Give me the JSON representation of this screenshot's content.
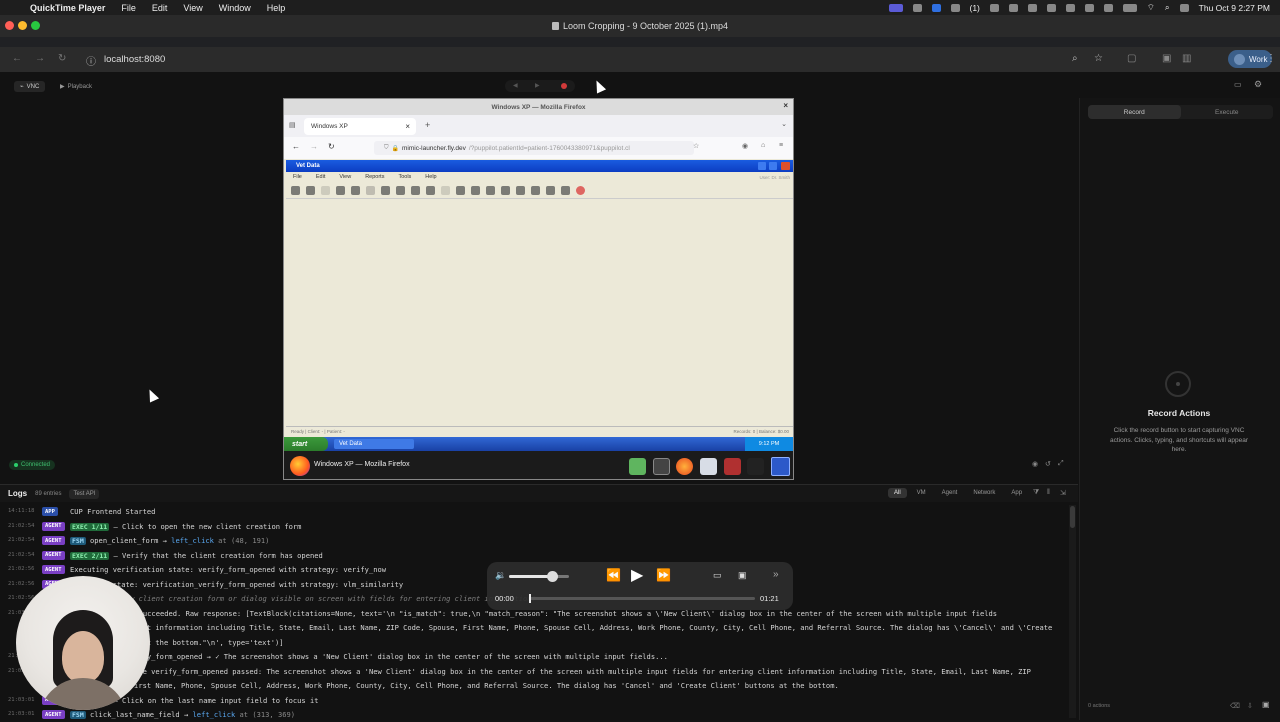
{
  "menubar": {
    "app": "QuickTime Player",
    "items": [
      "File",
      "Edit",
      "View",
      "Window",
      "Help"
    ],
    "status_count": "(1)",
    "clock": "Thu Oct 9  2:27 PM"
  },
  "window": {
    "title": "Loom Cropping - 9 October 2025 (1).mp4"
  },
  "browser": {
    "url": "localhost:8080",
    "profile_label": "Work"
  },
  "app": {
    "mode_tabs": [
      "VNC",
      "Playback"
    ],
    "connection_status": "Connected"
  },
  "vnc": {
    "window_title": "Windows XP — Mozilla Firefox",
    "tab_label": "Windows XP",
    "url_host": "mimic-launcher.fly.dev",
    "url_rest": "/?puppilot.patientId=patient-1760043380971&puppilot.cl",
    "vet_title": "Vet Data",
    "vet_menu": [
      "File",
      "Edit",
      "View",
      "Reports",
      "Tools",
      "Help"
    ],
    "vet_user": "User: Dr. Smith",
    "status_left": "Ready | Client: - | Patient: -",
    "status_right": "Records: 0 | Balance: $0.00",
    "start_label": "start",
    "task_item": "Vet Data",
    "clock": "9:12 PM",
    "host_task_label": "Windows XP — Mozilla Firefox"
  },
  "right_panel": {
    "tabs": [
      "Record",
      "Execute"
    ],
    "empty_title": "Record Actions",
    "empty_text": "Click the record button to start capturing VNC actions. Clicks, typing, and shortcuts will appear here.",
    "footer": "0 actions"
  },
  "logs": {
    "title": "Logs",
    "count": "89 entries",
    "test_api": "Test API",
    "filters": [
      "All",
      "VM",
      "Agent",
      "Network",
      "App"
    ],
    "entries": [
      {
        "ts": "14:11:18",
        "tag": "APP",
        "text": "CUP Frontend Started"
      },
      {
        "ts": "21:02:54",
        "tag": "AGENT",
        "badge": "EXEC 1/11",
        "text": " – Click to open the new client creation form"
      },
      {
        "ts": "21:02:54",
        "tag": "AGENT",
        "badge": "FSM",
        "text": " open_client_form → ",
        "action": "left_click",
        "tail": " at (48, 191)"
      },
      {
        "ts": "21:02:54",
        "tag": "AGENT",
        "badge": "EXEC 2/11",
        "text": " – Verify that the client creation form has opened"
      },
      {
        "ts": "21:02:56",
        "tag": "AGENT",
        "text": "Executing verification state: verify_form_opened with strategy: verify_now"
      },
      {
        "ts": "21:02:56",
        "tag": "AGENT",
        "text": "Executing state: verification_verify_form_opened with strategy: vlm_similarity"
      },
      {
        "ts": "21:02:56",
        "tag": "AGENT",
        "text": "🔍 – Is the new client creation form or dialog visible on screen with fields for entering client information?",
        "italic": true
      },
      {
        "ts": "21:03:00",
        "tag": "AGENT",
        "text": "✅ VLM API call succeeded. Raw response: [TextBlock(citations=None, text='\\n  \"is_match\": true,\\n  \"match_reason\": \"The screenshot shows a \\'New Client\\' dialog box in the center of the screen with multiple input fields"
      },
      {
        "ts": "",
        "tag": "",
        "text": "   for entering client information including Title, State, Email, Last Name, ZIP Code, Spouse, First Name, Phone, Spouse Cell, Address, Work Phone, County, City, Cell Phone, and Referral Source. The dialog has \\'Cancel\\' and \\'Create"
      },
      {
        "ts": "",
        "tag": "",
        "text": "   Client\\' buttons at the bottom.\"\\n', type='text')]"
      },
      {
        "ts": "21:03:00",
        "tag": "AGENT",
        "text": "verification_verify_form_opened → ✓ The screenshot shows a 'New Client' dialog box in the center of the screen with multiple input fields..."
      },
      {
        "ts": "21:03:00",
        "tag": "AGENT",
        "text": "Verification state verify_form_opened passed: The screenshot shows a 'New Client' dialog box in the center of the screen with multiple input fields for entering client information including Title, State, Email, Last Name, ZIP"
      },
      {
        "ts": "",
        "tag": "",
        "text": "   Code, Spouse, First Name, Phone, Spouse Cell, Address, Work Phone, County, City, Cell Phone, and Referral Source. The dialog has 'Cancel' and 'Create Client' buttons at the bottom."
      },
      {
        "ts": "21:03:01",
        "tag": "AGENT",
        "badge": "EXEC 3/11",
        "text": " – Click on the last name input field to focus it"
      },
      {
        "ts": "21:03:01",
        "tag": "AGENT",
        "badge": "FSM",
        "text": " click_last_name_field → ",
        "action": "left_click",
        "tail": " at (313, 369)"
      }
    ]
  },
  "player": {
    "current_time": "00:00",
    "duration": "01:21",
    "volume": 0.72,
    "progress": 0.0
  },
  "colors": {
    "agent": "#7a3fc4",
    "app": "#2b4fa8",
    "exec": "#1f6b3a",
    "fsm": "#1e5a7a",
    "connected": "#1f8a4a",
    "action": "#5aa9f2"
  }
}
